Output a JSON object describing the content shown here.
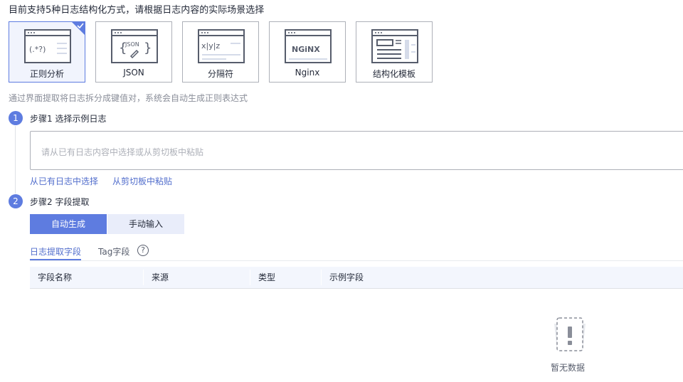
{
  "intro": "目前支持5种日志结构化方式，请根据日志内容的实际场景选择",
  "methods": [
    {
      "label": "正则分析",
      "icon": "regex-icon",
      "icon_text": "(.*?)"
    },
    {
      "label": "JSON",
      "icon": "json-icon",
      "icon_text": "JSON"
    },
    {
      "label": "分隔符",
      "icon": "delimiter-icon",
      "icon_text": "x|y|z"
    },
    {
      "label": "Nginx",
      "icon": "nginx-icon",
      "icon_text": "NGiNX"
    },
    {
      "label": "结构化模板",
      "icon": "template-icon",
      "icon_text": ""
    }
  ],
  "description": "通过界面提取将日志拆分成键值对，系统会自动生成正则表达式",
  "step1": {
    "number": "1",
    "title": "步骤1 选择示例日志",
    "placeholder": "请从已有日志内容中选择或从剪切板中粘贴",
    "link_existing": "从已有日志中选择",
    "link_clipboard": "从剪切板中粘贴"
  },
  "step2": {
    "number": "2",
    "title": "步骤2 字段提取",
    "btn_auto": "自动生成",
    "btn_manual": "手动输入"
  },
  "tabs": {
    "log_fields": "日志提取字段",
    "tag_fields": "Tag字段",
    "help": "?"
  },
  "table": {
    "columns": [
      "字段名称",
      "来源",
      "类型",
      "示例字段"
    ],
    "empty": "暂无数据"
  },
  "colors": {
    "accent": "#5e7ce0",
    "link": "#526ecc",
    "icon_stroke": "#575d6c"
  }
}
